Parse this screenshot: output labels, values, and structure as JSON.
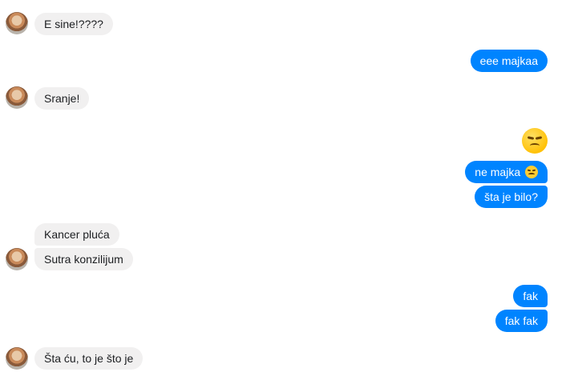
{
  "conversation": {
    "messages": [
      {
        "side": "in",
        "text": "E sine!????"
      },
      {
        "side": "out",
        "text": "eee majkaa"
      },
      {
        "side": "in",
        "text": "Sranje!"
      },
      {
        "side": "out",
        "emoji_only": "disappointed-face"
      },
      {
        "side": "out",
        "text": "ne majka",
        "trailing_emoji": "disappointed-face"
      },
      {
        "side": "out",
        "text": "šta je bilo?"
      },
      {
        "side": "in",
        "text": "Kancer pluća"
      },
      {
        "side": "in",
        "text": "Sutra konzilijum"
      },
      {
        "side": "out",
        "text": "fak"
      },
      {
        "side": "out",
        "text": "fak fak"
      },
      {
        "side": "in",
        "text": "Šta ću, to je što je"
      }
    ]
  },
  "colors": {
    "incoming_bubble": "#f1f0f0",
    "outgoing_bubble": "#0084ff",
    "emoji": "#ffcc33"
  }
}
